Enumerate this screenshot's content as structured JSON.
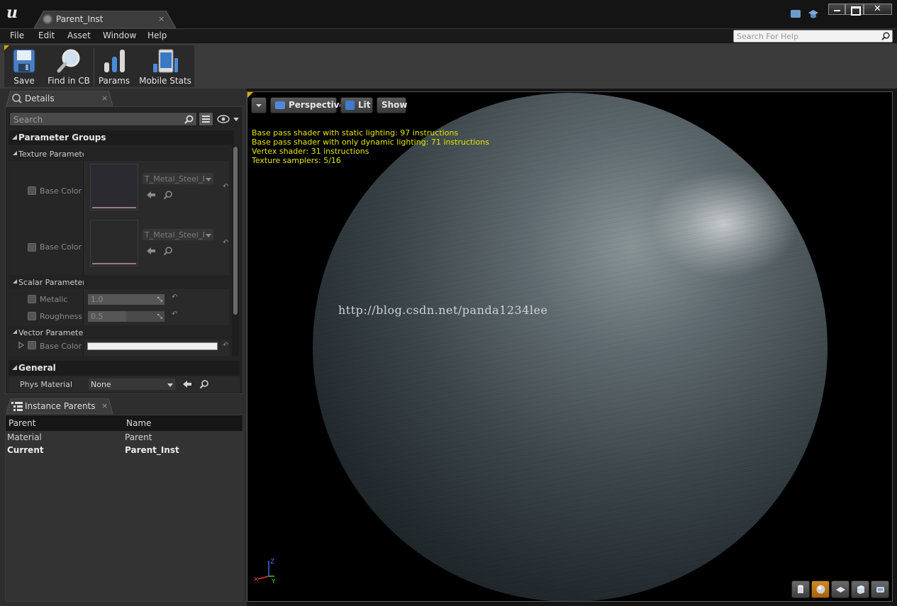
{
  "window": {
    "logo": "u",
    "tab_title": "Parent_Inst",
    "tab_close": "×",
    "close_glyph": "✕"
  },
  "menu": {
    "items": [
      "File",
      "Edit",
      "Asset",
      "Window",
      "Help"
    ],
    "help_search_placeholder": "Search For Help"
  },
  "toolbar": {
    "buttons": [
      {
        "label": "Save",
        "icon": "save-icon"
      },
      {
        "label": "Find in CB",
        "icon": "find-in-content-browser-icon"
      },
      {
        "label": "Params",
        "icon": "params-icon"
      },
      {
        "label": "Mobile Stats",
        "icon": "mobile-stats-icon"
      }
    ]
  },
  "details": {
    "tab_label": "Details",
    "tab_close": "×",
    "search_placeholder": "Search",
    "category_parameter_groups": "Parameter Groups",
    "texture_group": "Texture Parameter Values",
    "texture_params": [
      {
        "name": "Base Color Normal",
        "asset": "T_Metal_Steel_N"
      },
      {
        "name": "Base Color Texture",
        "asset": "T_Metal_Steel_D"
      }
    ],
    "scalar_group": "Scalar Parameter Values",
    "scalar_params": [
      {
        "name": "Metalic",
        "value": "1.0",
        "fill": 1.0
      },
      {
        "name": "Roughness",
        "value": "0.5",
        "fill": 0.5
      }
    ],
    "vector_group": "Vector Parameter Values",
    "vector_params": [
      {
        "name": "Base Color Tint",
        "color": "#f0f0f0"
      }
    ],
    "reset_glyph": "↶",
    "category_general": "General",
    "phys_material_label": "Phys Material",
    "phys_material_value": "None"
  },
  "instance_parents": {
    "tab_label": "Instance Parents",
    "tab_close": "×",
    "columns": [
      "Parent",
      "Name"
    ],
    "rows": [
      {
        "parent": "Material",
        "name": "Parent",
        "bold": false
      },
      {
        "parent": "Current",
        "name": "Parent_Inst",
        "bold": true
      }
    ]
  },
  "viewport": {
    "buttons": [
      "Perspective",
      "Lit",
      "Show"
    ],
    "stats": [
      "Base pass shader with static lighting: 97 instructions",
      "Base pass shader with only dynamic lighting: 71 instructions",
      "Vertex shader: 31 instructions",
      "Texture samplers: 5/16"
    ],
    "watermark": "http://blog.csdn.net/panda1234lee",
    "axis_labels": {
      "z": "Z",
      "y": "Y"
    },
    "preview_shapes": [
      "cylinder-icon",
      "sphere-icon",
      "plane-icon",
      "cube-icon",
      "custom-mesh-icon"
    ],
    "active_preview": "sphere-icon",
    "accent": "#d9a800"
  }
}
